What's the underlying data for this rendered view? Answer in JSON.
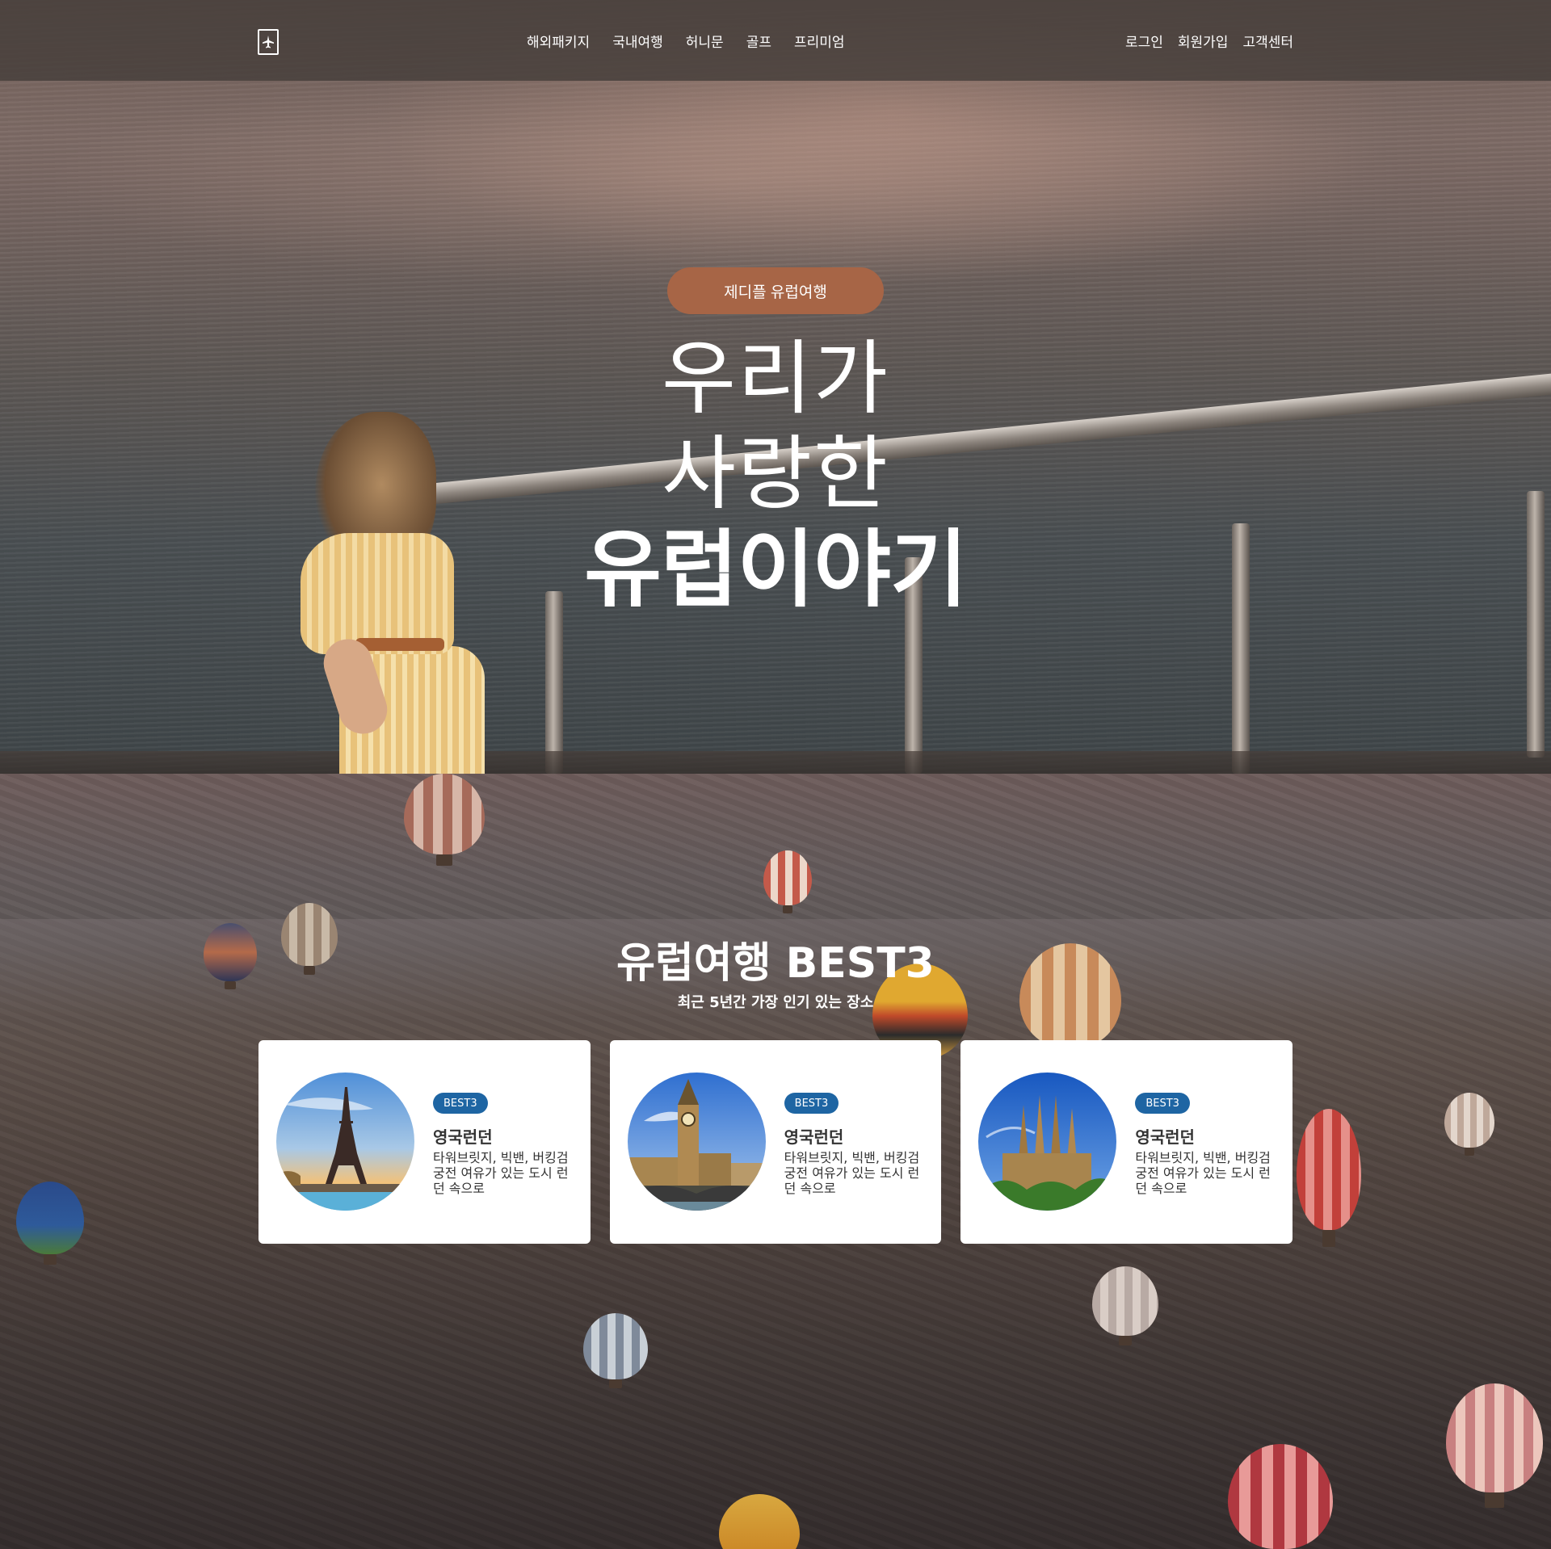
{
  "header": {
    "logo_icon": "airplane-icon",
    "nav_main": [
      "해외패키지",
      "국내여행",
      "허니문",
      "골프",
      "프리미엄"
    ],
    "nav_util": [
      "로그인",
      "회원가입",
      "고객센터"
    ]
  },
  "hero": {
    "pill": "제디플 유럽여행",
    "line1": "우리가",
    "line2": "사랑한",
    "line3": "유럽이야기"
  },
  "best": {
    "title": "유럽여행 BEST3",
    "subtitle": "최근 5년간 가장 인기 있는 장소",
    "cards": [
      {
        "badge": "BEST3",
        "title": "영국런던",
        "desc": "타워브릿지, 빅밴, 버킹검 궁전 여유가 있는 도시 런던 속으로",
        "image": "eiffel-tower"
      },
      {
        "badge": "BEST3",
        "title": "영국런던",
        "desc": "타워브릿지, 빅밴, 버킹검 궁전 여유가 있는 도시 런던 속으로",
        "image": "big-ben"
      },
      {
        "badge": "BEST3",
        "title": "영국런던",
        "desc": "타워브릿지, 빅밴, 버킹검 궁전 여유가 있는 도시 런던 속으로",
        "image": "sagrada-familia"
      }
    ]
  },
  "colors": {
    "accent_pill": "#a76546",
    "badge_blue": "#1e65a3",
    "header_bg": "#463e3a"
  }
}
